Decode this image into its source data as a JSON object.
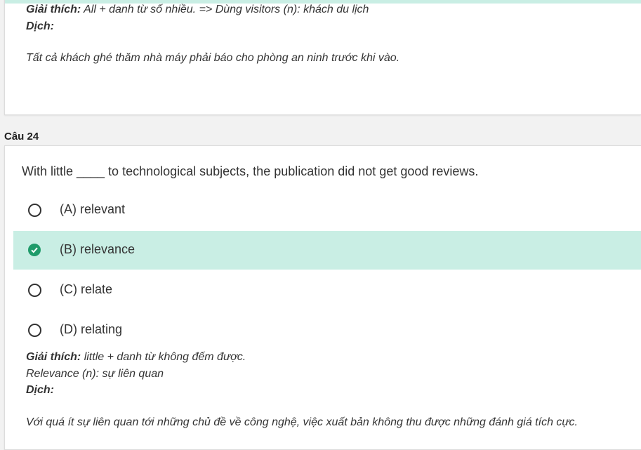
{
  "prev_question": {
    "explanation_label": "Giải thích:",
    "explanation_text": "All + danh từ số nhiều. => Dùng visitors (n): khách du lịch",
    "translate_label": "Dịch:",
    "translation": "Tất cả khách ghé thăm nhà máy phải báo cho phòng an ninh trước khi vào."
  },
  "question": {
    "header": "Câu 24",
    "text": "With little ____ to technological subjects, the publication did not get good reviews.",
    "options": [
      {
        "label": "(A) relevant",
        "selected": false
      },
      {
        "label": "(B) relevance",
        "selected": true
      },
      {
        "label": "(C) relate",
        "selected": false
      },
      {
        "label": "(D) relating",
        "selected": false
      }
    ],
    "explanation_label": "Giải thích:",
    "explanation_text": "little + danh từ không đếm được.",
    "explanation_line2": "Relevance (n): sự liên quan",
    "translate_label": "Dịch:",
    "translation": "Với quá ít sự liên quan tới những chủ đề về công nghệ, việc xuất bản không thu được những đánh giá tích cực."
  },
  "colors": {
    "selected_bg": "#c9eee4",
    "check_green": "#1f9b6a"
  }
}
